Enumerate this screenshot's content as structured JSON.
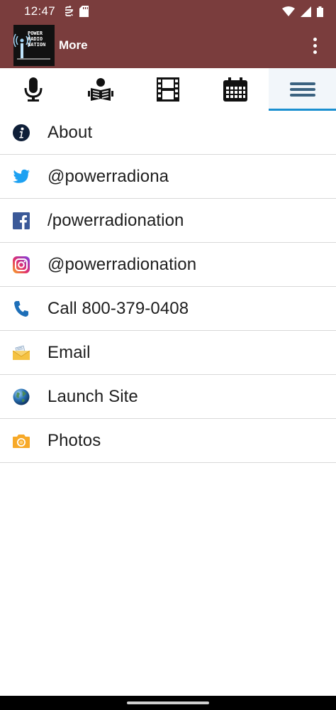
{
  "status_bar": {
    "time": "12:47",
    "left_icons": [
      "sync-icon",
      "sd-card-icon"
    ],
    "right_icons": [
      "wifi-icon",
      "cell-signal-icon",
      "battery-icon"
    ]
  },
  "app_bar": {
    "title": "More",
    "logo_text": "POWER RADIO NATION",
    "overflow_icon": "more-vert-icon",
    "color": "#7a3d3d"
  },
  "tabs": [
    {
      "name": "microphone-icon",
      "active": false
    },
    {
      "name": "news-reader-icon",
      "active": false
    },
    {
      "name": "film-icon",
      "active": false
    },
    {
      "name": "calendar-icon",
      "active": false
    },
    {
      "name": "menu-icon",
      "active": true
    }
  ],
  "accent_color": "#1a8fd0",
  "menu": {
    "items": [
      {
        "label": "About",
        "icon": "info-icon"
      },
      {
        "label": "@powerradiona",
        "icon": "twitter-icon"
      },
      {
        "label": "/powerradionation",
        "icon": "facebook-icon"
      },
      {
        "label": "@powerradionation",
        "icon": "instagram-icon"
      },
      {
        "label": "Call 800-379-0408",
        "icon": "phone-icon"
      },
      {
        "label": "Email",
        "icon": "email-icon"
      },
      {
        "label": "Launch Site",
        "icon": "globe-icon"
      },
      {
        "label": "Photos",
        "icon": "camera-icon"
      }
    ]
  }
}
